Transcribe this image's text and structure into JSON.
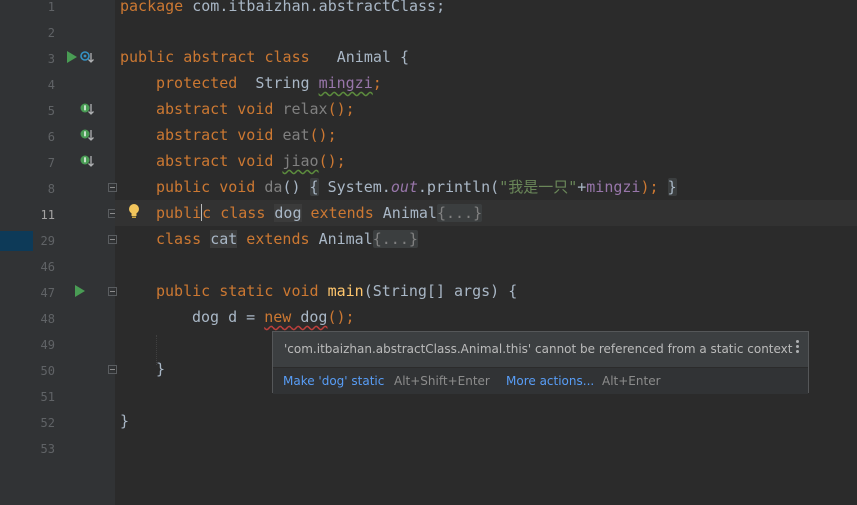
{
  "gutter": {
    "line_numbers": [
      "1",
      "2",
      "3",
      "4",
      "5",
      "6",
      "7",
      "8",
      "11",
      "29",
      "46",
      "47",
      "48",
      "49",
      "50",
      "51",
      "52",
      "53"
    ]
  },
  "code": {
    "l1": {
      "kw": "package",
      "rest": " com.itbaizhan.abstractClass;"
    },
    "l3": {
      "kw": "public abstract class",
      "gap": "   ",
      "name": "Animal",
      "rest": " {"
    },
    "l4": {
      "kw": "protected",
      "type": "  String ",
      "field": "mingzi",
      "end": ";"
    },
    "l5": {
      "kw": "abstract void ",
      "name": "relax",
      "end": "();"
    },
    "l6": {
      "kw": "abstract void ",
      "name": "eat",
      "end": "();"
    },
    "l7": {
      "kw": "abstract void ",
      "name": "jiao",
      "end": "();"
    },
    "l8": {
      "kw": "public void ",
      "name": "da",
      "paren": "() ",
      "ob": "{",
      "sys": " System.",
      "out": "out",
      "print": ".println(",
      "str": "\"我是一只\"",
      "plus": "+",
      "field": "mingzi",
      "semi": "); ",
      "cb": "}"
    },
    "l11": {
      "kw1a": "publi",
      "kw1b": "c",
      "kw2": " class ",
      "name": "dog",
      "kw3": " extends ",
      "parent": "Animal",
      "fold": "{...}"
    },
    "l29": {
      "kw1": "class ",
      "name": "cat",
      "kw2": " extends ",
      "parent": "Animal",
      "fold": "{...}"
    },
    "l47": {
      "kw": "public static void ",
      "name": "main",
      "rest": "(String[] args) {"
    },
    "l48": {
      "type": "dog d = ",
      "new_kw": "new",
      "rest": " dog",
      "end": "();"
    },
    "l50": {
      "brace": "}"
    },
    "l52": {
      "brace": "}"
    }
  },
  "popup": {
    "message": "'com.itbaizhan.abstractClass.Animal.this' cannot be referenced from a static context",
    "action1": "Make 'dog' static",
    "shortcut1": "Alt+Shift+Enter",
    "action2": "More actions...",
    "shortcut2": "Alt+Enter"
  },
  "colors": {
    "background": "#2b2b2b",
    "gutter": "#313335",
    "keyword": "#cc7832",
    "field": "#9876aa",
    "string": "#6a8759",
    "method": "#ffc66d",
    "link": "#589df6"
  }
}
